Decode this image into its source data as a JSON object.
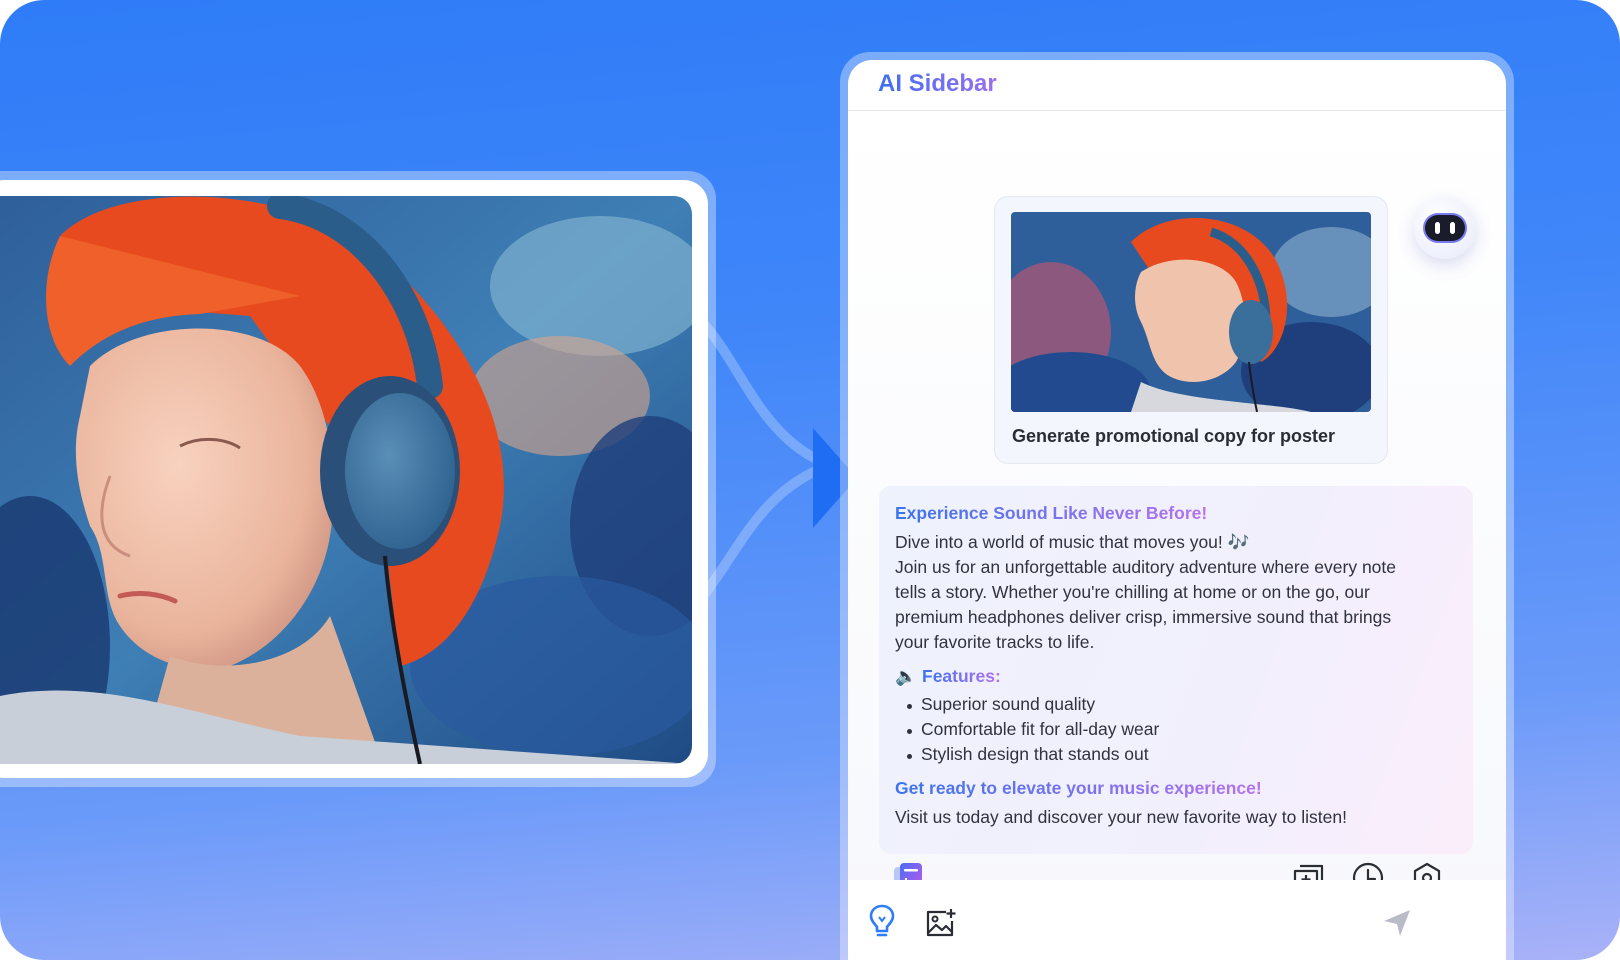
{
  "sidebar": {
    "title": "AI Sidebar"
  },
  "user_message": {
    "text": "Generate promotional copy for poster"
  },
  "response": {
    "headline": "Experience Sound Like Never Before!",
    "intro": "Dive into a world of music that moves you! 🎶",
    "body_lines": [
      "Join us for an unforgettable auditory adventure where every note",
      "tells a story. Whether you're chilling at home or on the go, our",
      "premium headphones deliver crisp, immersive sound that brings",
      "your favorite tracks to life."
    ],
    "features_icon": "🔈",
    "features_label": "Features:",
    "features": [
      "Superior sound quality",
      "Comfortable fit for all-day wear",
      "Stylish design that stands out"
    ],
    "cta_headline": "Get ready to elevate your music experience!",
    "cta_text": "Visit us today and discover your new favorite way to listen!"
  },
  "icons": {
    "bot_avatar": "robot-face-icon",
    "prompt_book": "prompt-book-icon",
    "new_chat": "new-chat-icon",
    "history": "clock-icon",
    "settings": "settings-hexagon-icon",
    "suggestions": "lightbulb-icon",
    "upload_image": "image-upload-icon",
    "send": "send-icon"
  },
  "colors": {
    "background": "#2f7cf8",
    "accent_blue": "#3b73ee",
    "accent_purple": "#b772ee"
  }
}
